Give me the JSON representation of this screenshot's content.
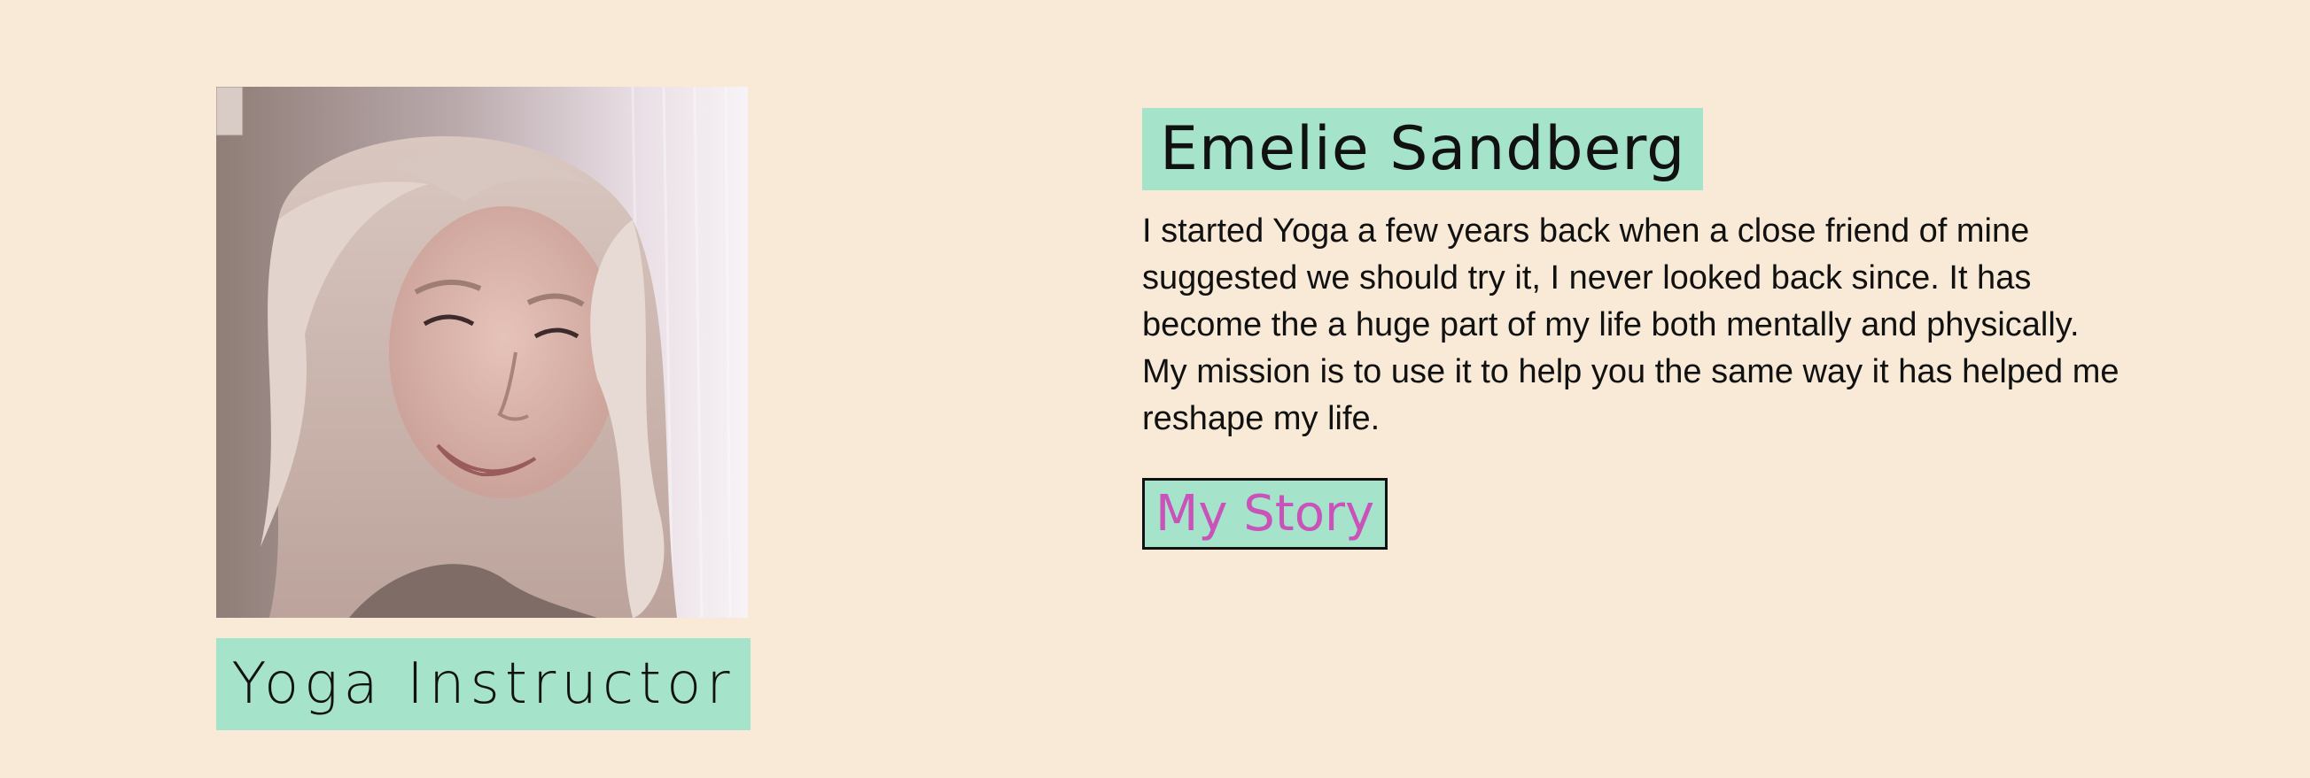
{
  "profile": {
    "name": "Emelie Sandberg",
    "role": "Yoga Instructor",
    "bio": "I started Yoga a few years back when a close friend of mine suggested we should try it, I never looked back since. It has become the a huge part of my life both mentally and physically. My mission is to use it to help you the same way it has helped me reshape my life.",
    "story_button_label": "My Story",
    "photo_alt": "Emelie Sandberg"
  },
  "colors": {
    "background": "#f8ead6",
    "accent": "#a5e4cb",
    "link": "#c953b9",
    "text": "#111111"
  }
}
